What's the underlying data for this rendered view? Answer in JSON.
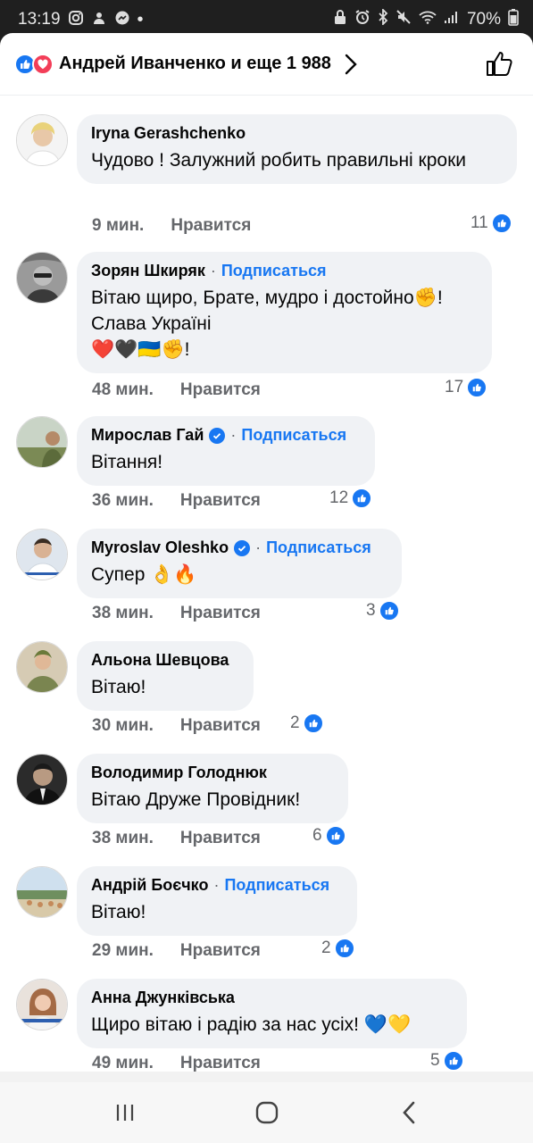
{
  "status_bar": {
    "time": "13:19",
    "battery": "70%"
  },
  "header": {
    "reactors": "Андрей Иванченко и еще 1 988"
  },
  "comments": [
    {
      "author": "Iryna Gerashchenko",
      "verified": false,
      "follow": "",
      "text": "Чудово ! Залужний робить правильні кроки",
      "time": "9 мин.",
      "like_label": "Нравится",
      "likes": "11"
    },
    {
      "author": "Зорян Шкиряк",
      "verified": false,
      "follow": "Подписаться",
      "text_lines": [
        "Вітаю щиро, Брате, мудро і достойно✊!",
        "Слава Україні",
        "❤️🖤🇺🇦✊!"
      ],
      "time": "48 мин.",
      "like_label": "Нравится",
      "likes": "17"
    },
    {
      "author": "Мирослав Гай",
      "verified": true,
      "follow": "Подписаться",
      "text": "Вітання!",
      "time": "36 мин.",
      "like_label": "Нравится",
      "likes": "12"
    },
    {
      "author": "Myroslav Oleshko",
      "verified": true,
      "follow": "Подписаться",
      "text": "Супер 👌🔥",
      "time": "38 мин.",
      "like_label": "Нравится",
      "likes": "3"
    },
    {
      "author": "Альона Шевцова",
      "verified": false,
      "follow": "",
      "text": "Вітаю!",
      "time": "30 мин.",
      "like_label": "Нравится",
      "likes": "2"
    },
    {
      "author": "Володимир Голоднюк",
      "verified": false,
      "follow": "",
      "text": "Вітаю Друже Провідник!",
      "time": "38 мин.",
      "like_label": "Нравится",
      "likes": "6"
    },
    {
      "author": "Андрій Боєчко",
      "verified": false,
      "follow": "Подписаться",
      "text": "Вітаю!",
      "time": "29 мин.",
      "like_label": "Нравится",
      "likes": "2"
    },
    {
      "author": "Анна Джунківська",
      "verified": false,
      "follow": "",
      "text": "Щиро вітаю і радію за нас усіх! 💙💛",
      "time": "49 мин.",
      "like_label": "Нравится",
      "likes": "5"
    }
  ],
  "separator": "·",
  "colors": {
    "accent": "#1877f2",
    "love": "#f33e58",
    "bubble": "#f0f2f5",
    "meta": "#65676b"
  }
}
